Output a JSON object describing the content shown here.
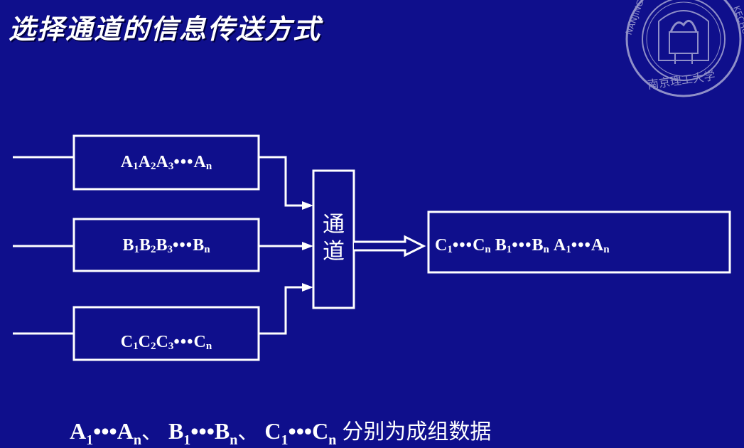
{
  "title": "选择通道的信息传送方式",
  "boxes": {
    "a": {
      "letter": "A",
      "sub1": "1",
      "sub2": "2",
      "sub3": "3",
      "dots": "•••",
      "subn": "n"
    },
    "b": {
      "letter": "B",
      "sub1": "1",
      "sub2": "2",
      "sub3": "3",
      "dots": "•••",
      "subn": "n"
    },
    "c": {
      "letter": "C",
      "sub1": "1",
      "sub2": "2",
      "sub3": "3",
      "dots": "•••",
      "subn": "n"
    }
  },
  "channel": {
    "line1": "通",
    "line2": "道"
  },
  "output": {
    "c_letter": "C",
    "c_sub1": "1",
    "c_subn": "n",
    "b_letter": "B",
    "b_sub1": "1",
    "b_subn": "n",
    "a_letter": "A",
    "a_sub1": "1",
    "a_subn": "n",
    "dots": "•••"
  },
  "footer": {
    "a_letter": "A",
    "b_letter": "B",
    "c_letter": "C",
    "sub1": "1",
    "subn": "n",
    "dots": "•••",
    "sep": "、",
    "text": "分别为成组数据"
  },
  "colors": {
    "background": "#0f0f8c",
    "foreground": "#ffffff",
    "seal": "#8f8fc8"
  }
}
